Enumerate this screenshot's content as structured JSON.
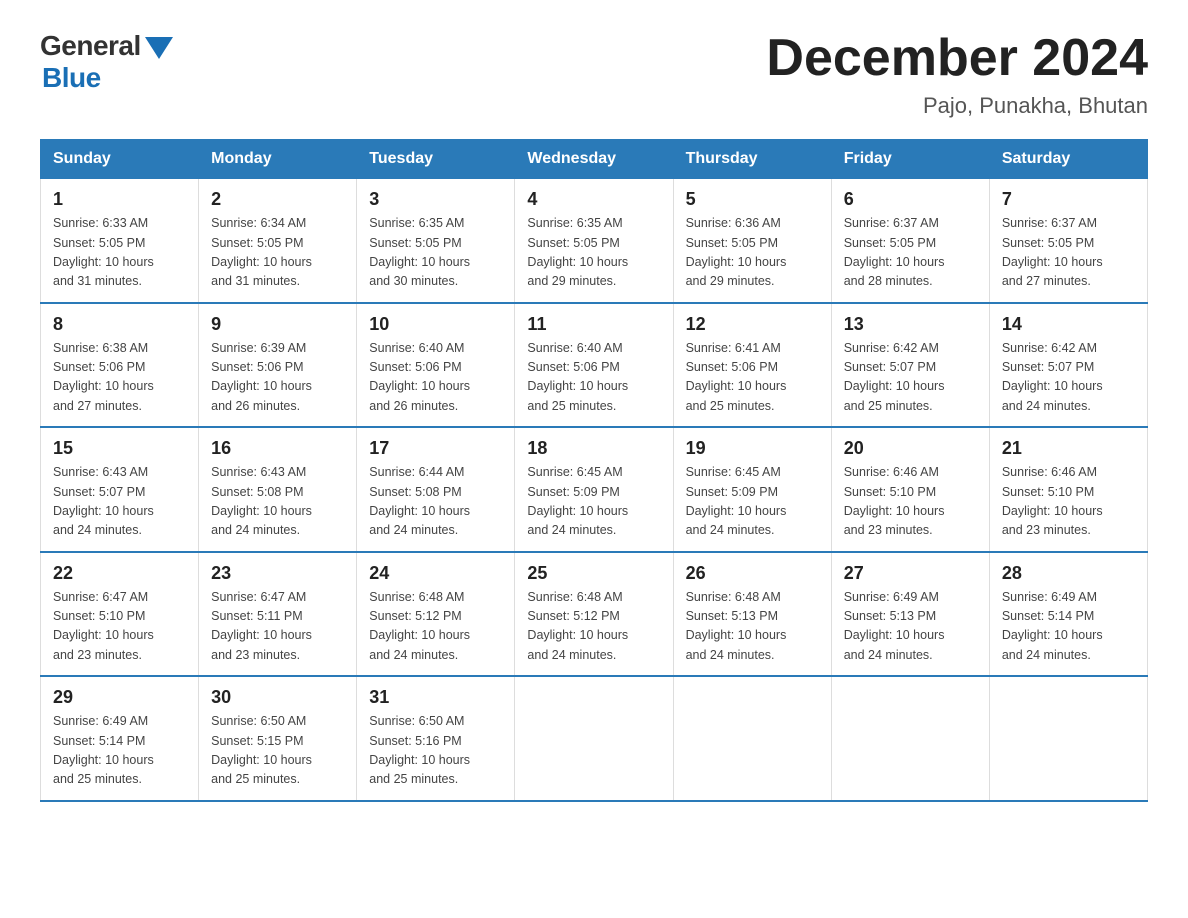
{
  "logo": {
    "general": "General",
    "blue": "Blue"
  },
  "title": "December 2024",
  "location": "Pajo, Punakha, Bhutan",
  "days_of_week": [
    "Sunday",
    "Monday",
    "Tuesday",
    "Wednesday",
    "Thursday",
    "Friday",
    "Saturday"
  ],
  "weeks": [
    [
      {
        "day": "1",
        "sunrise": "6:33 AM",
        "sunset": "5:05 PM",
        "daylight": "10 hours and 31 minutes."
      },
      {
        "day": "2",
        "sunrise": "6:34 AM",
        "sunset": "5:05 PM",
        "daylight": "10 hours and 31 minutes."
      },
      {
        "day": "3",
        "sunrise": "6:35 AM",
        "sunset": "5:05 PM",
        "daylight": "10 hours and 30 minutes."
      },
      {
        "day": "4",
        "sunrise": "6:35 AM",
        "sunset": "5:05 PM",
        "daylight": "10 hours and 29 minutes."
      },
      {
        "day": "5",
        "sunrise": "6:36 AM",
        "sunset": "5:05 PM",
        "daylight": "10 hours and 29 minutes."
      },
      {
        "day": "6",
        "sunrise": "6:37 AM",
        "sunset": "5:05 PM",
        "daylight": "10 hours and 28 minutes."
      },
      {
        "day": "7",
        "sunrise": "6:37 AM",
        "sunset": "5:05 PM",
        "daylight": "10 hours and 27 minutes."
      }
    ],
    [
      {
        "day": "8",
        "sunrise": "6:38 AM",
        "sunset": "5:06 PM",
        "daylight": "10 hours and 27 minutes."
      },
      {
        "day": "9",
        "sunrise": "6:39 AM",
        "sunset": "5:06 PM",
        "daylight": "10 hours and 26 minutes."
      },
      {
        "day": "10",
        "sunrise": "6:40 AM",
        "sunset": "5:06 PM",
        "daylight": "10 hours and 26 minutes."
      },
      {
        "day": "11",
        "sunrise": "6:40 AM",
        "sunset": "5:06 PM",
        "daylight": "10 hours and 25 minutes."
      },
      {
        "day": "12",
        "sunrise": "6:41 AM",
        "sunset": "5:06 PM",
        "daylight": "10 hours and 25 minutes."
      },
      {
        "day": "13",
        "sunrise": "6:42 AM",
        "sunset": "5:07 PM",
        "daylight": "10 hours and 25 minutes."
      },
      {
        "day": "14",
        "sunrise": "6:42 AM",
        "sunset": "5:07 PM",
        "daylight": "10 hours and 24 minutes."
      }
    ],
    [
      {
        "day": "15",
        "sunrise": "6:43 AM",
        "sunset": "5:07 PM",
        "daylight": "10 hours and 24 minutes."
      },
      {
        "day": "16",
        "sunrise": "6:43 AM",
        "sunset": "5:08 PM",
        "daylight": "10 hours and 24 minutes."
      },
      {
        "day": "17",
        "sunrise": "6:44 AM",
        "sunset": "5:08 PM",
        "daylight": "10 hours and 24 minutes."
      },
      {
        "day": "18",
        "sunrise": "6:45 AM",
        "sunset": "5:09 PM",
        "daylight": "10 hours and 24 minutes."
      },
      {
        "day": "19",
        "sunrise": "6:45 AM",
        "sunset": "5:09 PM",
        "daylight": "10 hours and 24 minutes."
      },
      {
        "day": "20",
        "sunrise": "6:46 AM",
        "sunset": "5:10 PM",
        "daylight": "10 hours and 23 minutes."
      },
      {
        "day": "21",
        "sunrise": "6:46 AM",
        "sunset": "5:10 PM",
        "daylight": "10 hours and 23 minutes."
      }
    ],
    [
      {
        "day": "22",
        "sunrise": "6:47 AM",
        "sunset": "5:10 PM",
        "daylight": "10 hours and 23 minutes."
      },
      {
        "day": "23",
        "sunrise": "6:47 AM",
        "sunset": "5:11 PM",
        "daylight": "10 hours and 23 minutes."
      },
      {
        "day": "24",
        "sunrise": "6:48 AM",
        "sunset": "5:12 PM",
        "daylight": "10 hours and 24 minutes."
      },
      {
        "day": "25",
        "sunrise": "6:48 AM",
        "sunset": "5:12 PM",
        "daylight": "10 hours and 24 minutes."
      },
      {
        "day": "26",
        "sunrise": "6:48 AM",
        "sunset": "5:13 PM",
        "daylight": "10 hours and 24 minutes."
      },
      {
        "day": "27",
        "sunrise": "6:49 AM",
        "sunset": "5:13 PM",
        "daylight": "10 hours and 24 minutes."
      },
      {
        "day": "28",
        "sunrise": "6:49 AM",
        "sunset": "5:14 PM",
        "daylight": "10 hours and 24 minutes."
      }
    ],
    [
      {
        "day": "29",
        "sunrise": "6:49 AM",
        "sunset": "5:14 PM",
        "daylight": "10 hours and 25 minutes."
      },
      {
        "day": "30",
        "sunrise": "6:50 AM",
        "sunset": "5:15 PM",
        "daylight": "10 hours and 25 minutes."
      },
      {
        "day": "31",
        "sunrise": "6:50 AM",
        "sunset": "5:16 PM",
        "daylight": "10 hours and 25 minutes."
      },
      null,
      null,
      null,
      null
    ]
  ],
  "labels": {
    "sunrise": "Sunrise:",
    "sunset": "Sunset:",
    "daylight": "Daylight:"
  }
}
